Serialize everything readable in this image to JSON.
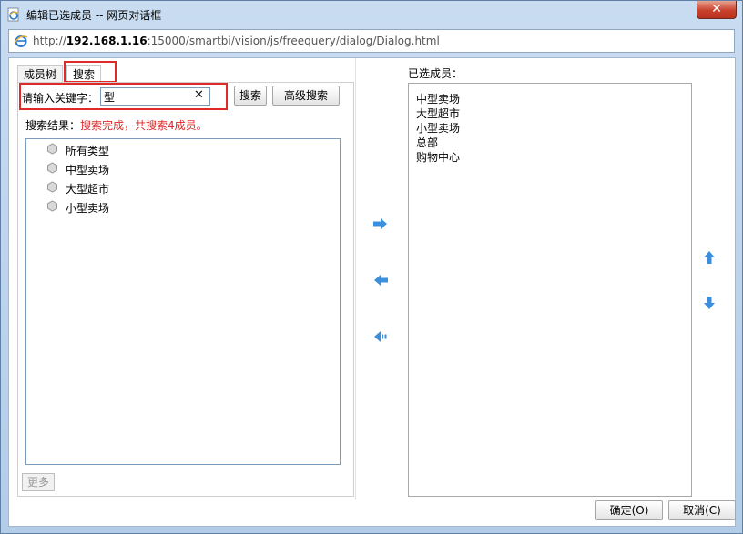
{
  "window": {
    "title": "编辑已选成员 -- 网页对话框",
    "close_label": "✕",
    "url_prefix": "http://",
    "url_host": "192.168.1.16",
    "url_rest": ":15000/smartbi/vision/js/freequery/dialog/Dialog.html"
  },
  "tabs": [
    {
      "label": "成员树",
      "active": false
    },
    {
      "label": "搜索",
      "active": true
    }
  ],
  "search": {
    "keyword_label": "请输入关键字：",
    "keyword_value": "型",
    "clear_label": "✕",
    "search_button": "搜索",
    "advanced_button": "高级搜索",
    "result_label": "搜索结果：",
    "result_status": "搜索完成，共搜索4成员。",
    "results": [
      "所有类型",
      "中型卖场",
      "大型超市",
      "小型卖场"
    ],
    "more_button": "更多"
  },
  "selected": {
    "label": "已选成员：",
    "items": [
      "中型卖场",
      "大型超市",
      "小型卖场",
      "总部",
      "购物中心"
    ]
  },
  "footer": {
    "ok_button": "确定(O)",
    "cancel_button": "取消(C)"
  },
  "colors": {
    "accent_red": "#e02a2a",
    "arrow_blue": "#3b8fdc"
  }
}
